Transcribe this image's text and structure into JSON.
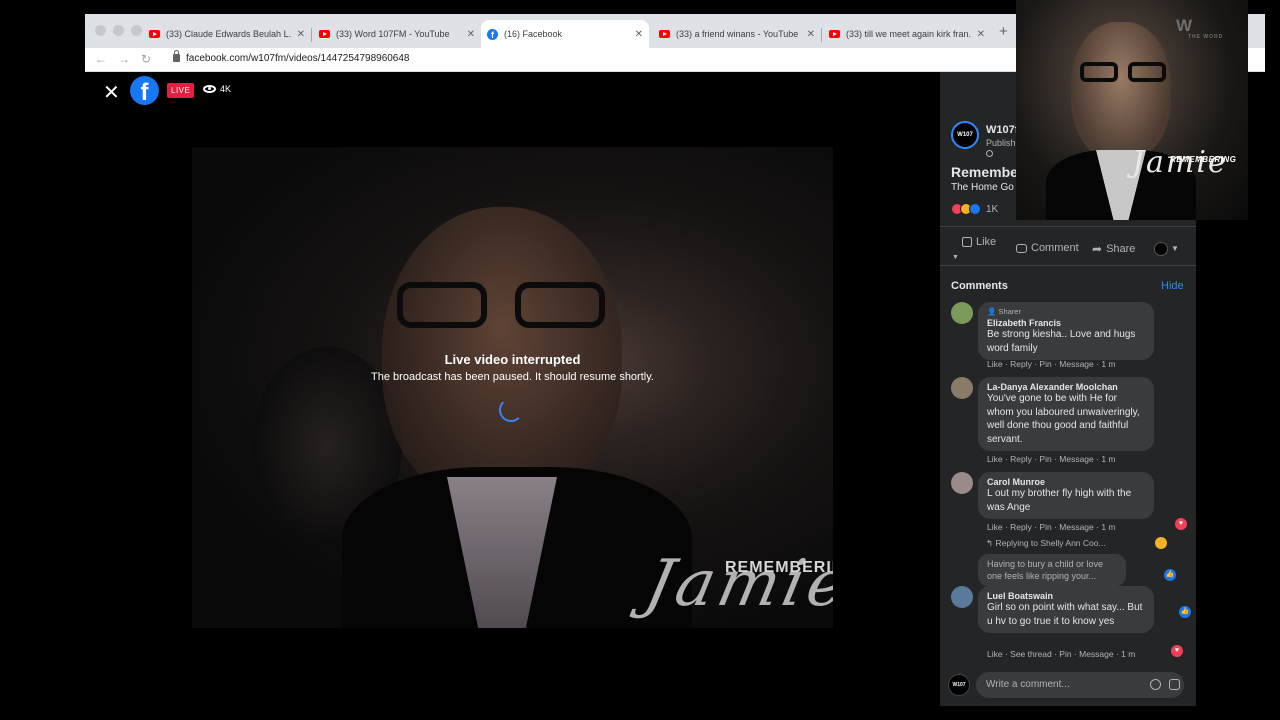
{
  "browser": {
    "tabs": [
      {
        "title": "(33) Claude Edwards Beulah L...",
        "favicon": "youtube-icon",
        "active": false
      },
      {
        "title": "(33) Word 107FM - YouTube",
        "favicon": "youtube-icon",
        "active": false
      },
      {
        "title": "(16) Facebook",
        "favicon": "facebook-icon",
        "active": true
      },
      {
        "title": "(33) a friend winans - YouTube",
        "favicon": "youtube-icon",
        "active": false
      },
      {
        "title": "(33) till we meet again kirk fran...",
        "favicon": "youtube-icon",
        "active": false
      }
    ],
    "new_tab": "+",
    "url": "facebook.com/w107fm/videos/1447254798960648"
  },
  "video": {
    "close": "✕",
    "fb_logo": "f",
    "live_label": "LIVE",
    "viewer_count": "4K",
    "interrupt_title": "Live video interrupted",
    "interrupt_subtitle": "The broadcast has been paused. It should resume shortly.",
    "overlay_remembering": "REMEMBERING",
    "overlay_name": "Jamie"
  },
  "panel": {
    "page_avatar_text": "W107",
    "page_name": "W107f",
    "published_text": "Publish",
    "video_title": "Remembe",
    "video_subtitle": "The Home Go",
    "reaction_count": "1K",
    "actions": {
      "like": "Like",
      "comment": "Comment",
      "share": "Share"
    },
    "comments_heading": "Comments",
    "hide_label": "Hide",
    "comments": [
      {
        "badge": "Sharer",
        "name": "Elizabeth Francis",
        "text": "Be strong kiesha.. Love and hugs word family",
        "meta": "Like · Reply · Pin · Message · 1 m"
      },
      {
        "badge": "",
        "name": "La-Danya Alexander Moolchan",
        "text": "You've gone to be with He for whom you laboured unwaiveringly, well done thou good and faithful servant.",
        "meta": "Like · Reply · Pin · Message · 1 m"
      },
      {
        "badge": "",
        "name": "Carol Munroe",
        "text": "L out my brother fly high with the was Ange",
        "meta": "Like · Reply · Pin · Message · 1 m"
      },
      {
        "badge": "",
        "name": "Luel Boatswain",
        "text": "Girl so on point with what say... But u hv to go true it to know yes",
        "meta": "Like · See thread · Pin · Message · 1 m"
      }
    ],
    "replying_to": "Replying to Shelly Ann Coo...",
    "reply_preview": "Having to bury a child or love one feels like ripping your...",
    "composer_placeholder": "Write a comment...",
    "composer_avatar_text": "W107"
  },
  "thumbnail": {
    "logo": "W",
    "logo_sub": "THE WORD",
    "remembering": "REMEMBERING",
    "name": "Jamie"
  },
  "colors": {
    "facebook_blue": "#1877f2",
    "live_red": "#e41e3f",
    "panel_bg": "#242526",
    "bubble_bg": "#3a3b3c",
    "link_blue": "#2d88ff"
  }
}
